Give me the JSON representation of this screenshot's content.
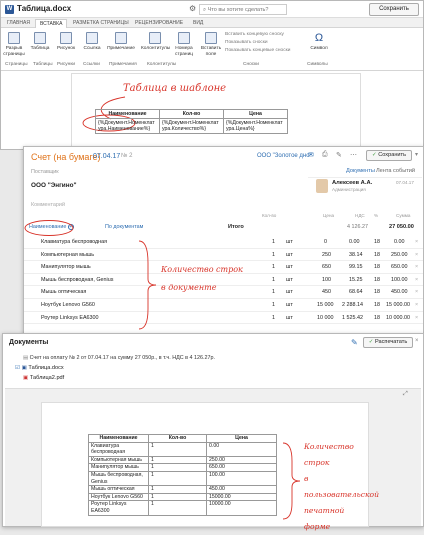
{
  "word": {
    "doc_icon": "W",
    "title": "Таблица.docx",
    "search_placeholder": "Что вы хотите сделать?",
    "save_label": "Сохранить",
    "tabs": [
      "ГЛАВНАЯ",
      "ВСТАВКА",
      "РАЗМЕТКА СТРАНИЦЫ",
      "РЕЦЕНЗИРОВАНИЕ",
      "ВИД"
    ],
    "ribbon_buttons": [
      "Разрыв страницы",
      "Таблица",
      "Рисунок",
      "Ссылка",
      "Примечание",
      "Колонтитулы",
      "Номера страниц",
      "Вставить поле",
      "Символ"
    ],
    "ribbon_options": [
      "Вставить концевую сноску",
      "Показывать сноски",
      "Показывать концевые сноски"
    ],
    "ribbon_groups": [
      "Страницы",
      "Таблицы",
      "Рисунки",
      "Ссылки",
      "Примечания",
      "Колонтитулы",
      "Сноски",
      "Символы"
    ],
    "annotation": "Таблица в шаблоне",
    "template_table": {
      "headers": [
        "Наименование",
        "Кол-во",
        "Цена"
      ],
      "row": [
        "{%Документ.Номенклатура.Наименование%}",
        "{%Документ.Номенклатура.Количество%}",
        "{%Документ.Номенклатура.Цена%}"
      ]
    }
  },
  "invoice": {
    "title": "Счет (на бумаге)",
    "date": "07.04.17",
    "number": "№ 2",
    "org_link": "ООО \"Золотое дно\"",
    "save_label": "Сохранить",
    "links": [
      "Документы",
      "Лента событий"
    ],
    "supplier_label": "Поставщик",
    "client": "ООО \"Энгино\"",
    "user_name": "Алексеев А.А.",
    "user_role": "Администрация",
    "user_date": "07.04.17",
    "comment_placeholder": "Комментарий",
    "col_headers": [
      "Кол-во",
      "Цена",
      "НДС",
      "%",
      "Сумма"
    ],
    "filter_name": "Наименование",
    "filter_docs": "По документам",
    "total_label": "Итого",
    "total_nds": "4 126.27",
    "total_sum": "27 050.00",
    "annotation_line1": "Количество строк",
    "annotation_line2": "в документе",
    "rows": [
      {
        "name": "Клавиатура беспроводная",
        "qty": "1",
        "unit": "шт",
        "price": "0",
        "nds": "0.00",
        "rate": "18",
        "sum": "0.00"
      },
      {
        "name": "Компьютерная мышь",
        "qty": "1",
        "unit": "шт",
        "price": "250",
        "nds": "38.14",
        "rate": "18",
        "sum": "250.00"
      },
      {
        "name": "Манипулятор мышь",
        "qty": "1",
        "unit": "шт",
        "price": "650",
        "nds": "99.15",
        "rate": "18",
        "sum": "650.00"
      },
      {
        "name": "Мышь беспроводная, Genius",
        "qty": "1",
        "unit": "шт",
        "price": "100",
        "nds": "15.25",
        "rate": "18",
        "sum": "100.00"
      },
      {
        "name": "Мышь оптическая",
        "qty": "1",
        "unit": "шт",
        "price": "450",
        "nds": "68.64",
        "rate": "18",
        "sum": "450.00"
      },
      {
        "name": "Ноутбук Lenovo G560",
        "qty": "1",
        "unit": "шт",
        "price": "15 000",
        "nds": "2 288.14",
        "rate": "18",
        "sum": "15 000.00"
      },
      {
        "name": "Роутер Linksys EA6300",
        "qty": "1",
        "unit": "шт",
        "price": "10 000",
        "nds": "1 525.42",
        "rate": "18",
        "sum": "10 000.00"
      }
    ]
  },
  "documents": {
    "title": "Документы",
    "print_label": "Распечатать",
    "caption": "Счет на оплату № 2 от 07.04.17 на сумму 27 050р., в т.ч. НДС в 4 126.27р.",
    "files": [
      "Таблица.docx",
      "Таблица2.pdf"
    ],
    "annotation_lines": [
      "Количество строк",
      "в пользовательской",
      "печатной форме"
    ],
    "table": {
      "headers": [
        "Наименование",
        "Кол-во",
        "Цена"
      ],
      "rows": [
        [
          "Клавиатура беспроводная",
          "1",
          "0.00"
        ],
        [
          "Компьютерная мышь",
          "1",
          "250.00"
        ],
        [
          "Манипулятор мышь",
          "1",
          "650.00"
        ],
        [
          "Мышь беспроводная, Genius",
          "1",
          "100.00"
        ],
        [
          "Мышь оптическая",
          "1",
          "450.00"
        ],
        [
          "Ноутбук Lenovo G560",
          "1",
          "15000.00"
        ],
        [
          "Роутер Linksys EA6300",
          "1",
          "10000.00"
        ]
      ]
    }
  },
  "colors": {
    "accent": "#e0741c",
    "link": "#2d6db1",
    "annotation": "#d8342a"
  }
}
